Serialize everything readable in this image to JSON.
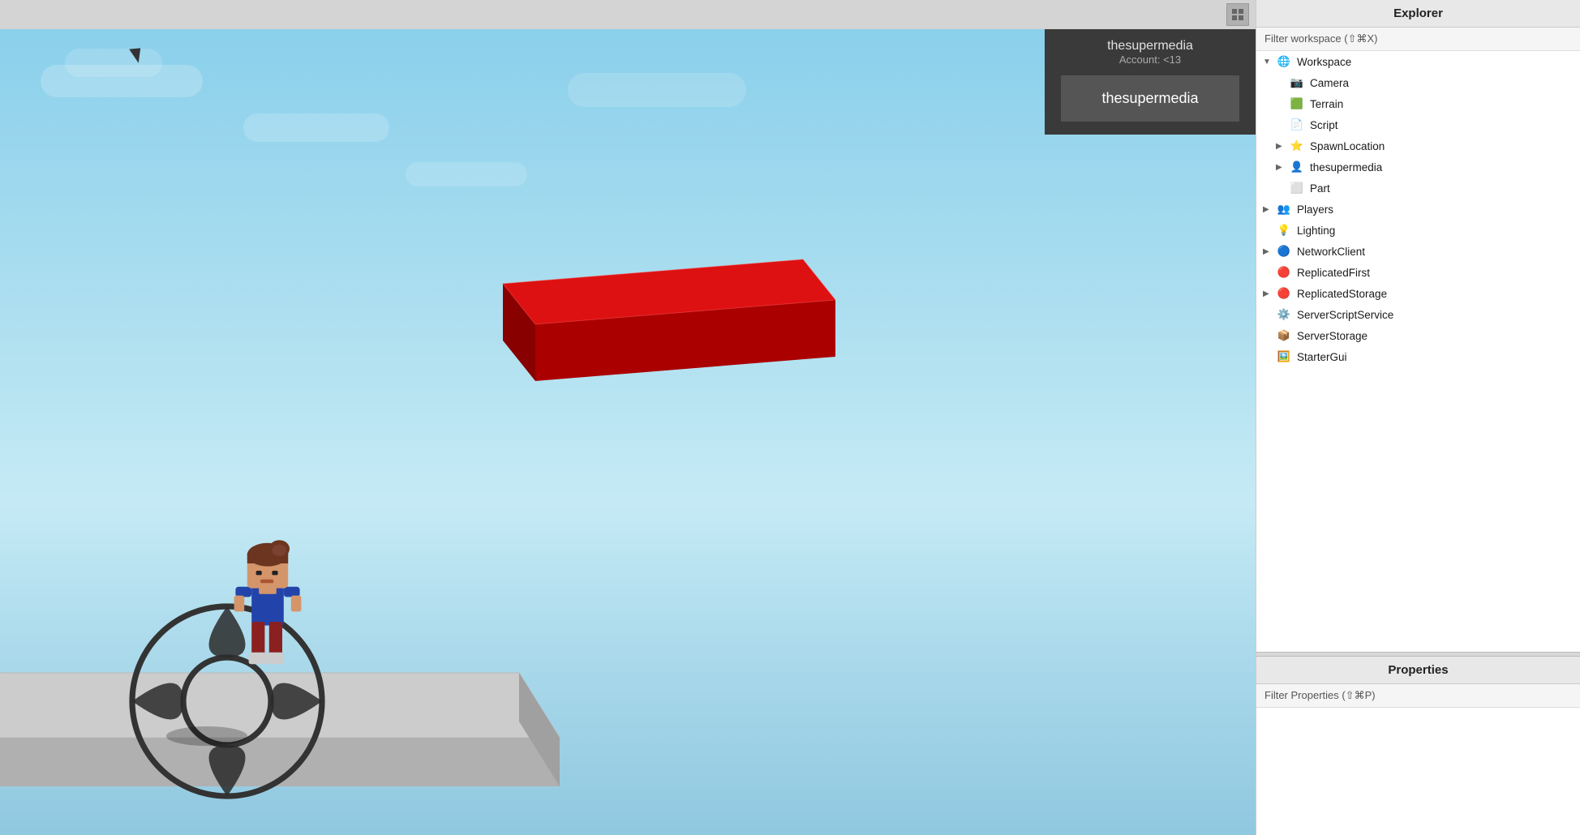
{
  "viewport": {
    "user": {
      "name": "thesupermedia",
      "account_label": "Account: <13",
      "button_label": "thesupermedia"
    }
  },
  "explorer": {
    "title": "Explorer",
    "filter_placeholder": "Filter workspace (⇧⌘X)",
    "tree": [
      {
        "id": "workspace",
        "label": "Workspace",
        "indent": 0,
        "icon": "globe",
        "arrow": "▼",
        "expanded": true
      },
      {
        "id": "camera",
        "label": "Camera",
        "indent": 1,
        "icon": "camera",
        "arrow": ""
      },
      {
        "id": "terrain",
        "label": "Terrain",
        "indent": 1,
        "icon": "terrain",
        "arrow": ""
      },
      {
        "id": "script",
        "label": "Script",
        "indent": 1,
        "icon": "script",
        "arrow": ""
      },
      {
        "id": "spawnlocation",
        "label": "SpawnLocation",
        "indent": 1,
        "icon": "spawn",
        "arrow": "▶"
      },
      {
        "id": "thesupermedia",
        "label": "thesupermedia",
        "indent": 1,
        "icon": "player",
        "arrow": "▶"
      },
      {
        "id": "part",
        "label": "Part",
        "indent": 1,
        "icon": "part",
        "arrow": ""
      },
      {
        "id": "players",
        "label": "Players",
        "indent": 0,
        "icon": "players",
        "arrow": "▶"
      },
      {
        "id": "lighting",
        "label": "Lighting",
        "indent": 0,
        "icon": "lighting",
        "arrow": ""
      },
      {
        "id": "networkclient",
        "label": "NetworkClient",
        "indent": 0,
        "icon": "network",
        "arrow": "▶"
      },
      {
        "id": "replicatedfirst",
        "label": "ReplicatedFirst",
        "indent": 0,
        "icon": "replicated",
        "arrow": ""
      },
      {
        "id": "replicatedstorage",
        "label": "ReplicatedStorage",
        "indent": 0,
        "icon": "replicated",
        "arrow": "▶"
      },
      {
        "id": "serverscriptservice",
        "label": "ServerScriptService",
        "indent": 0,
        "icon": "service",
        "arrow": ""
      },
      {
        "id": "serverstorage",
        "label": "ServerStorage",
        "indent": 0,
        "icon": "storage",
        "arrow": ""
      },
      {
        "id": "startergui",
        "label": "StarterGui",
        "indent": 0,
        "icon": "gui",
        "arrow": ""
      }
    ]
  },
  "properties": {
    "title": "Properties",
    "filter_placeholder": "Filter Properties (⇧⌘P)"
  }
}
